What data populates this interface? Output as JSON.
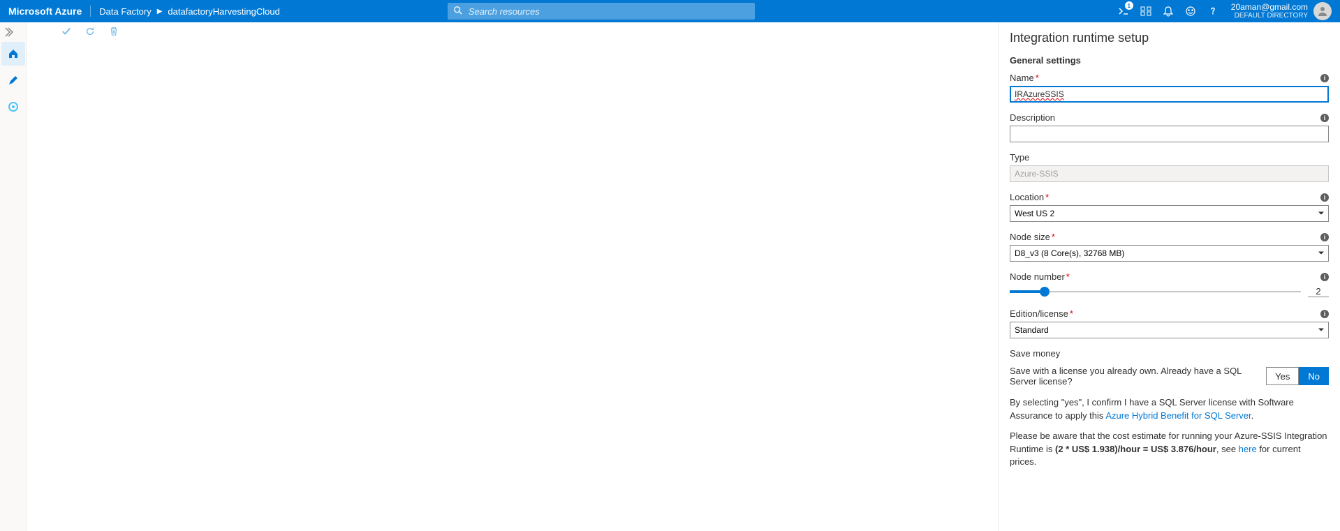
{
  "header": {
    "brand": "Microsoft Azure",
    "breadcrumb": [
      "Data Factory",
      "datafactoryHarvestingCloud"
    ],
    "search_placeholder": "Search resources",
    "notification_badge": "1",
    "user_email": "20aman@gmail.com",
    "user_directory": "DEFAULT DIRECTORY"
  },
  "panel": {
    "title": "Integration runtime setup",
    "section": "General settings",
    "fields": {
      "name_label": "Name",
      "name_value": "IRAzureSSIS",
      "description_label": "Description",
      "description_value": "",
      "type_label": "Type",
      "type_value": "Azure-SSIS",
      "location_label": "Location",
      "location_value": "West US 2",
      "node_size_label": "Node size",
      "node_size_value": "D8_v3 (8 Core(s), 32768 MB)",
      "node_number_label": "Node number",
      "node_number_value": "2",
      "edition_label": "Edition/license",
      "edition_value": "Standard"
    },
    "save_money": {
      "title": "Save money",
      "question": "Save with a license you already own. Already have a SQL Server license?",
      "yes": "Yes",
      "no": "No",
      "confirm_prefix": "By selecting \"yes\", I confirm I have a SQL Server license with Software Assurance to apply this ",
      "confirm_link": "Azure Hybrid Benefit for SQL Server",
      "cost_prefix": "Please be aware that the cost estimate for running your Azure-SSIS Integration Runtime is ",
      "cost_bold": "(2 * US$ 1.938)/hour = US$ 3.876/hour",
      "cost_mid": ", see ",
      "cost_link": "here",
      "cost_suffix": " for current prices."
    }
  }
}
